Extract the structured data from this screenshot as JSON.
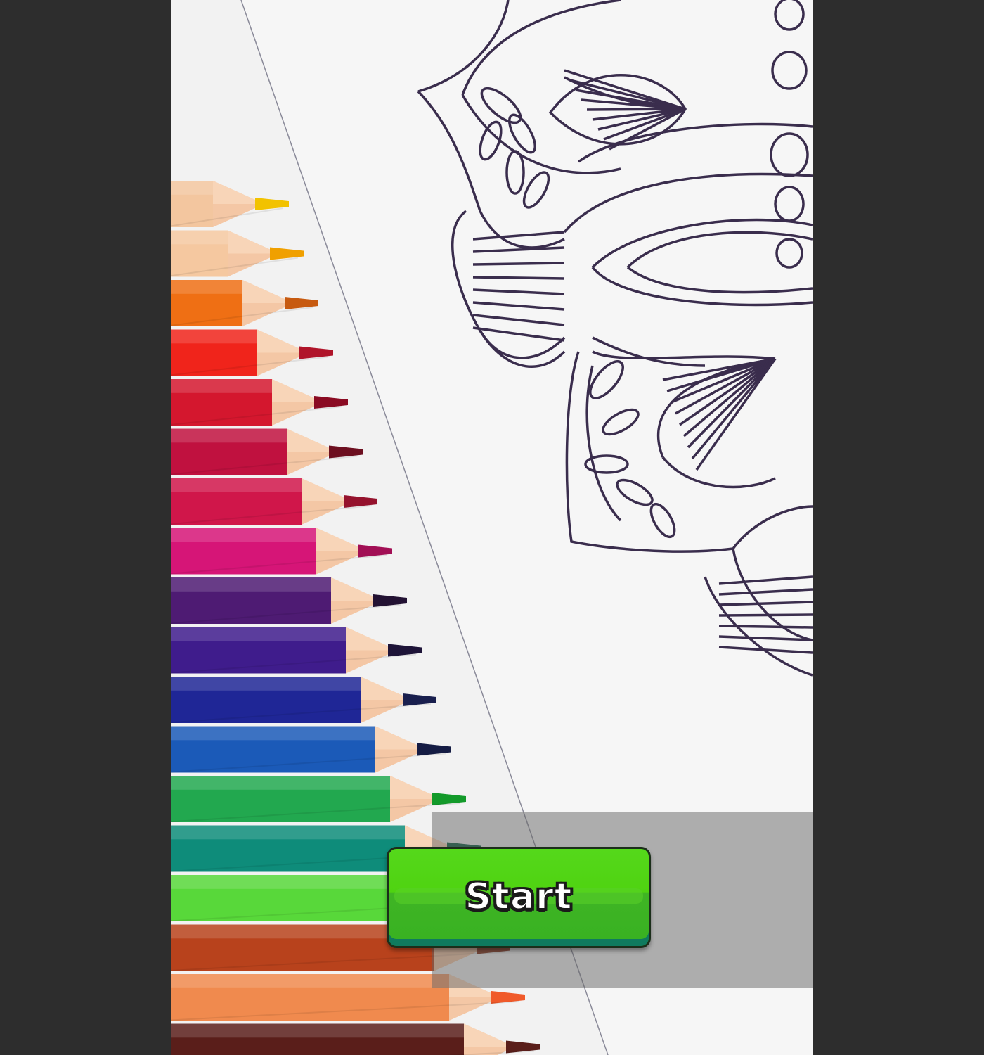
{
  "screen": {
    "name": "title-screen",
    "background_color": "#2d2d2d",
    "paper_color": "#efefef"
  },
  "artwork": {
    "description_icon": "mandala-outline-icon",
    "line_color": "#3a2d4d",
    "pencil_colors": [
      {
        "body": "#f3c69f",
        "tip": "#f2c200"
      },
      {
        "body": "#f5c8a0",
        "tip": "#f0a000"
      },
      {
        "body": "#ef6f14",
        "tip": "#c75a10"
      },
      {
        "body": "#f0241b",
        "tip": "#b0142a"
      },
      {
        "body": "#d4172e",
        "tip": "#8a0a22"
      },
      {
        "body": "#c0113f",
        "tip": "#6d0f20"
      },
      {
        "body": "#d0164a",
        "tip": "#95122d"
      },
      {
        "body": "#d61577",
        "tip": "#a20f55"
      },
      {
        "body": "#4e1b73",
        "tip": "#231233"
      },
      {
        "body": "#3f1c8c",
        "tip": "#1e1438"
      },
      {
        "body": "#1f2696",
        "tip": "#191f4e"
      },
      {
        "body": "#1b5ab8",
        "tip": "#151c44"
      },
      {
        "body": "#22a84f",
        "tip": "#139a2a"
      },
      {
        "body": "#0e8c7a",
        "tip": "#0a5d41"
      },
      {
        "body": "#58d83a",
        "tip": "#3fa82c"
      },
      {
        "body": "#b8421c",
        "tip": "#8a2f14"
      },
      {
        "body": "#f08a4e",
        "tip": "#f05a2a"
      },
      {
        "body": "#5a1e1a",
        "tip": "#5a1e1a"
      }
    ]
  },
  "start_panel": {
    "button_label": "Start",
    "button_color": "#4fd311"
  }
}
